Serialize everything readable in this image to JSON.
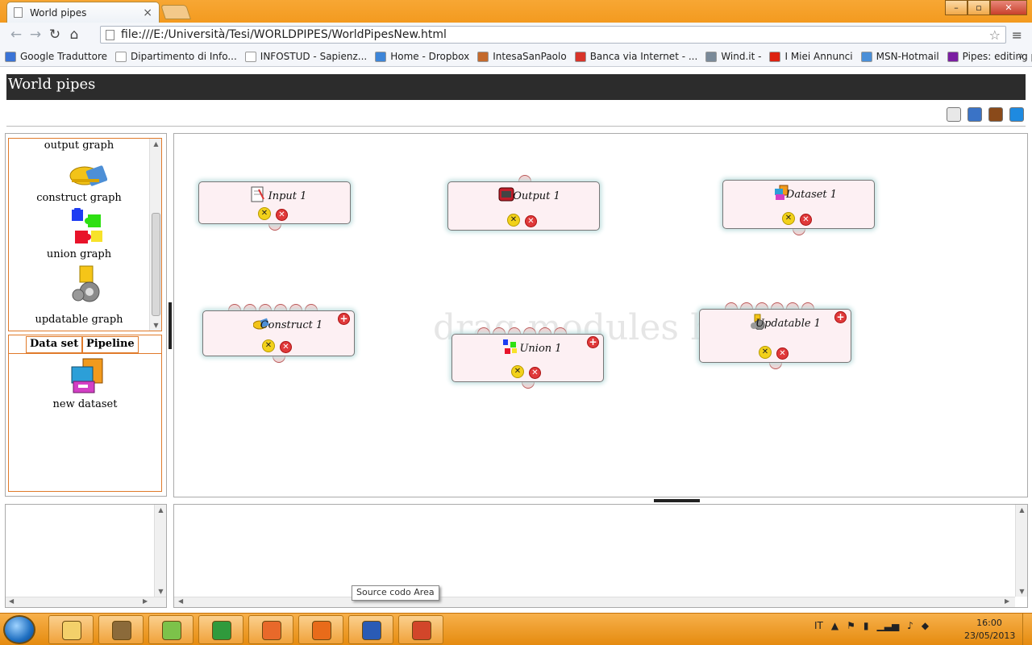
{
  "browser": {
    "tab_title": "World pipes",
    "tab_close": "×",
    "url": "file:///E:/Università/Tesi/WORLDPIPES/WorldPipesNew.html",
    "window_buttons": {
      "minimize": "–",
      "maximize": "▫",
      "close": "✕"
    }
  },
  "bookmarks": [
    {
      "label": "Google Traduttore",
      "icon": "translate-icon",
      "color": "#3a73d6"
    },
    {
      "label": "Dipartimento di Info...",
      "icon": "page-icon",
      "color": "#ffffff"
    },
    {
      "label": "INFOSTUD - Sapienz...",
      "icon": "page-icon",
      "color": "#ffffff"
    },
    {
      "label": "Home - Dropbox",
      "icon": "dropbox-icon",
      "color": "#3d85d8"
    },
    {
      "label": "IntesaSanPaolo",
      "icon": "bank-icon",
      "color": "#c46a2d"
    },
    {
      "label": "Banca via Internet - ...",
      "icon": "no-entry-icon",
      "color": "#d8342a"
    },
    {
      "label": "Wind.it -",
      "icon": "wind-icon",
      "color": "#7a8a99"
    },
    {
      "label": "I Miei Annunci",
      "icon": "ebay-icon",
      "color": "#d21"
    },
    {
      "label": "MSN-Hotmail",
      "icon": "msn-icon",
      "color": "#4a8fd8"
    },
    {
      "label": "Pipes: editing pipe",
      "icon": "yahoo-icon",
      "color": "#7b1fa2"
    }
  ],
  "app": {
    "title": "World pipes",
    "tools": [
      {
        "name": "new-pipe-icon",
        "color": "#e8e8e8"
      },
      {
        "name": "save-icon",
        "color": "#3a73c6"
      },
      {
        "name": "briefcase-icon",
        "color": "#8a4a1a"
      },
      {
        "name": "run-icon",
        "color": "#1e8ae0"
      }
    ]
  },
  "library": {
    "items": [
      {
        "label": "output graph"
      },
      {
        "label": "construct graph",
        "icon": "construct-icon"
      },
      {
        "label": "union graph",
        "icon": "puzzle-icon"
      },
      {
        "label": "updatable graph",
        "icon": "updatable-icon"
      }
    ]
  },
  "panel_tabs": {
    "dataset_tab": "Data set",
    "pipeline_tab": "Pipeline",
    "new_dataset_label": "new dataset"
  },
  "canvas": {
    "watermark": "drag modules h",
    "modules": [
      {
        "label": "Input 1",
        "icon": "notepad-icon"
      },
      {
        "label": "Output 1",
        "icon": "tv-icon"
      },
      {
        "label": "Dataset 1",
        "icon": "dataset-icon"
      },
      {
        "label": "Construct 1",
        "icon": "construct-icon"
      },
      {
        "label": "Union 1",
        "icon": "puzzle-icon"
      },
      {
        "label": "Updatable 1",
        "icon": "updatable-icon"
      }
    ]
  },
  "tooltip": "Source codo Area",
  "taskbar": {
    "language": "IT",
    "time": "16:00",
    "date": "23/05/2013",
    "apps": [
      {
        "name": "explorer-app-icon",
        "color": "#f3d06a"
      },
      {
        "name": "gimp-app-icon",
        "color": "#8b6a3a"
      },
      {
        "name": "notepadpp-app-icon",
        "color": "#7cc24a"
      },
      {
        "name": "chrome-app-icon",
        "color": "#2f9a3c"
      },
      {
        "name": "firefox-app-icon",
        "color": "#e8692a"
      },
      {
        "name": "mail-app-icon",
        "color": "#e86b1a"
      },
      {
        "name": "word-app-icon",
        "color": "#2a5bb5"
      },
      {
        "name": "powerpoint-app-icon",
        "color": "#d2462a"
      }
    ]
  }
}
